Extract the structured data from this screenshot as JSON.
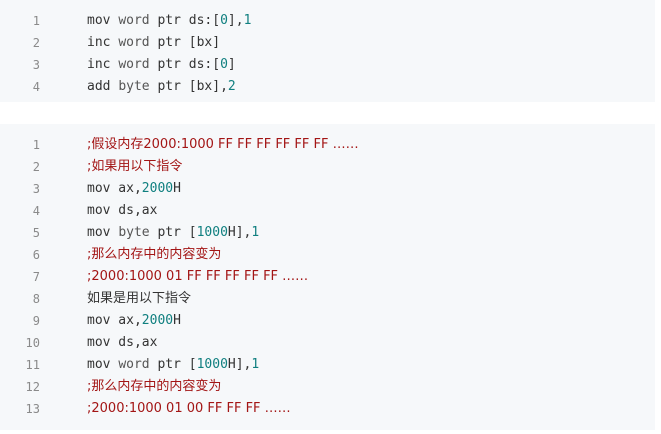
{
  "code_blocks": [
    {
      "lines": [
        {
          "number": "1",
          "tokens": [
            {
              "text": "mov ",
              "kind": "plain"
            },
            {
              "text": "word",
              "kind": "type"
            },
            {
              "text": " ptr ds:[",
              "kind": "plain"
            },
            {
              "text": "0",
              "kind": "num"
            },
            {
              "text": "],",
              "kind": "plain"
            },
            {
              "text": "1",
              "kind": "num"
            }
          ]
        },
        {
          "number": "2",
          "tokens": [
            {
              "text": "inc ",
              "kind": "plain"
            },
            {
              "text": "word",
              "kind": "type"
            },
            {
              "text": " ptr [bx]",
              "kind": "plain"
            }
          ]
        },
        {
          "number": "3",
          "tokens": [
            {
              "text": "inc ",
              "kind": "plain"
            },
            {
              "text": "word",
              "kind": "type"
            },
            {
              "text": " ptr ds:[",
              "kind": "plain"
            },
            {
              "text": "0",
              "kind": "num"
            },
            {
              "text": "]",
              "kind": "plain"
            }
          ]
        },
        {
          "number": "4",
          "tokens": [
            {
              "text": "add ",
              "kind": "plain"
            },
            {
              "text": "byte",
              "kind": "type"
            },
            {
              "text": " ptr [bx],",
              "kind": "plain"
            },
            {
              "text": "2",
              "kind": "num"
            }
          ]
        }
      ]
    },
    {
      "lines": [
        {
          "number": "1",
          "tokens": [
            {
              "text": ";假设内存2000:1000 FF FF FF FF FF FF ……",
              "kind": "cmt"
            }
          ]
        },
        {
          "number": "2",
          "tokens": [
            {
              "text": ";如果用以下指令",
              "kind": "cmt"
            }
          ]
        },
        {
          "number": "3",
          "tokens": [
            {
              "text": "mov ax,",
              "kind": "plain"
            },
            {
              "text": "2000",
              "kind": "num"
            },
            {
              "text": "H",
              "kind": "plain"
            }
          ]
        },
        {
          "number": "4",
          "tokens": [
            {
              "text": "mov ds,ax",
              "kind": "plain"
            }
          ]
        },
        {
          "number": "5",
          "tokens": [
            {
              "text": "mov ",
              "kind": "plain"
            },
            {
              "text": "byte",
              "kind": "type"
            },
            {
              "text": " ptr [",
              "kind": "plain"
            },
            {
              "text": "1000",
              "kind": "num"
            },
            {
              "text": "H],",
              "kind": "plain"
            },
            {
              "text": "1",
              "kind": "num"
            }
          ]
        },
        {
          "number": "6",
          "tokens": [
            {
              "text": ";那么内存中的内容变为",
              "kind": "cmt"
            }
          ]
        },
        {
          "number": "7",
          "tokens": [
            {
              "text": ";2000:1000 01 FF FF FF FF FF ……",
              "kind": "cmt"
            }
          ]
        },
        {
          "number": "8",
          "tokens": [
            {
              "text": "如果是用以下指令",
              "kind": "plain"
            }
          ]
        },
        {
          "number": "9",
          "tokens": [
            {
              "text": "mov ax,",
              "kind": "plain"
            },
            {
              "text": "2000",
              "kind": "num"
            },
            {
              "text": "H",
              "kind": "plain"
            }
          ]
        },
        {
          "number": "10",
          "tokens": [
            {
              "text": "mov ds,ax",
              "kind": "plain"
            }
          ]
        },
        {
          "number": "11",
          "tokens": [
            {
              "text": "mov ",
              "kind": "plain"
            },
            {
              "text": "word",
              "kind": "type"
            },
            {
              "text": " ptr [",
              "kind": "plain"
            },
            {
              "text": "1000",
              "kind": "num"
            },
            {
              "text": "H],",
              "kind": "plain"
            },
            {
              "text": "1",
              "kind": "num"
            }
          ]
        },
        {
          "number": "12",
          "tokens": [
            {
              "text": ";那么内存中的内容变为",
              "kind": "cmt"
            }
          ]
        },
        {
          "number": "13",
          "tokens": [
            {
              "text": ";2000:1000 01 00 FF FF FF ……",
              "kind": "cmt"
            }
          ]
        }
      ]
    }
  ],
  "colors": {
    "block_background": "#f6f8fa",
    "line_number": "#8a8a8a",
    "plain": "#333333",
    "number": "#0f7f7f",
    "comment": "#a31515"
  }
}
